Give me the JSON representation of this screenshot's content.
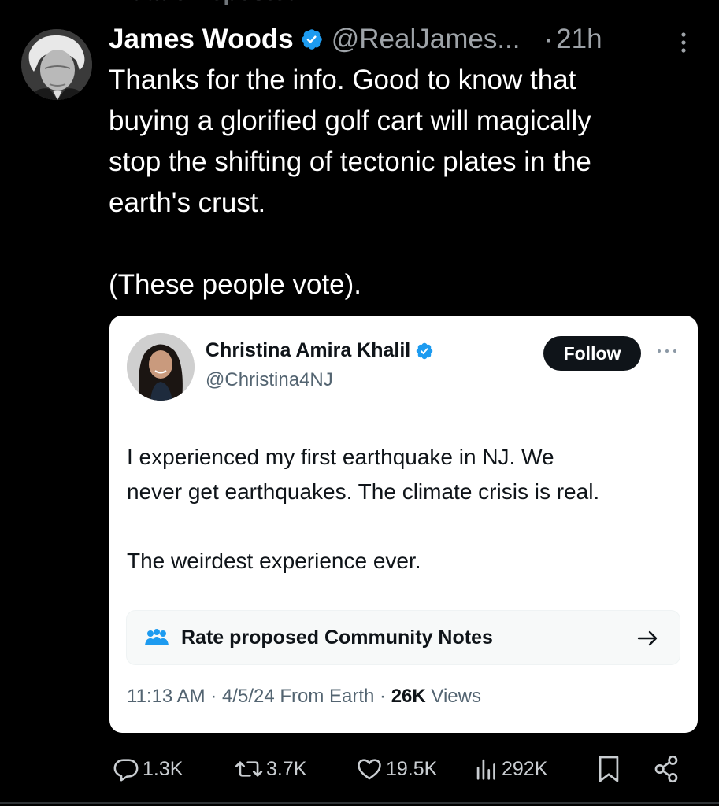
{
  "repost_label": "mdadoxreposted",
  "post": {
    "author_name": "James Woods",
    "author_handle": "@RealJames...",
    "dot": "·",
    "time": "21h",
    "text": "Thanks for the info. Good to know that\nbuying a glorified golf cart will magically\nstop the shifting of tectonic plates in the\nearth's crust.\n\n(These people vote)."
  },
  "quote": {
    "author_name": "Christina Amira Khalil",
    "author_handle": "@Christina4NJ",
    "follow_label": "Follow",
    "text": "I experienced my first earthquake in NJ. We\nnever get earthquakes. The climate crisis is real.\n\nThe weirdest experience ever.",
    "community_notes_label": "Rate proposed Community Notes",
    "meta_time": "11:13 AM · 4/5/24 From Earth · ",
    "meta_views_count": "26K",
    "meta_views_label": " Views"
  },
  "actions": {
    "replies": "1.3K",
    "reposts": "3.7K",
    "likes": "19.5K",
    "views": "292K"
  },
  "colors": {
    "background": "#000000",
    "verified_blue": "#1d9bf0",
    "card_background": "#ffffff",
    "muted_text": "#9ea3a8"
  },
  "icons": [
    "verified-badge-icon",
    "more-icon",
    "community-notes-icon",
    "arrow-right-icon",
    "reply-icon",
    "repost-icon",
    "like-icon",
    "views-icon",
    "bookmark-icon",
    "share-icon"
  ]
}
